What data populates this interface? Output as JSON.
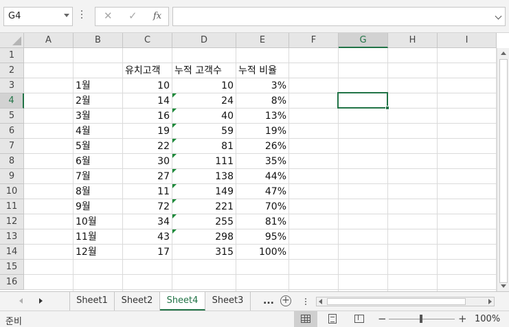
{
  "formula_bar": {
    "name_box": "G4",
    "cancel_icon": "✕",
    "enter_icon": "✓",
    "fx_icon": "fx",
    "formula": ""
  },
  "columns": [
    "A",
    "B",
    "C",
    "D",
    "E",
    "F",
    "G",
    "H",
    "I"
  ],
  "rows": [
    "1",
    "2",
    "3",
    "4",
    "5",
    "6",
    "7",
    "8",
    "9",
    "10",
    "11",
    "12",
    "13",
    "14",
    "15",
    "16"
  ],
  "selected_cell": "G4",
  "headers": {
    "c": "유치고객",
    "d": "누적 고객수",
    "e": "누적 비율"
  },
  "table": [
    {
      "month": "1월",
      "customers": "10",
      "cumulative": "10",
      "ratio": "3%"
    },
    {
      "month": "2월",
      "customers": "14",
      "cumulative": "24",
      "ratio": "8%"
    },
    {
      "month": "3월",
      "customers": "16",
      "cumulative": "40",
      "ratio": "13%"
    },
    {
      "month": "4월",
      "customers": "19",
      "cumulative": "59",
      "ratio": "19%"
    },
    {
      "month": "5월",
      "customers": "22",
      "cumulative": "81",
      "ratio": "26%"
    },
    {
      "month": "6월",
      "customers": "30",
      "cumulative": "111",
      "ratio": "35%"
    },
    {
      "month": "7월",
      "customers": "27",
      "cumulative": "138",
      "ratio": "44%"
    },
    {
      "month": "8월",
      "customers": "11",
      "cumulative": "149",
      "ratio": "47%"
    },
    {
      "month": "9월",
      "customers": "72",
      "cumulative": "221",
      "ratio": "70%"
    },
    {
      "month": "10월",
      "customers": "34",
      "cumulative": "255",
      "ratio": "81%"
    },
    {
      "month": "11월",
      "customers": "43",
      "cumulative": "298",
      "ratio": "95%"
    },
    {
      "month": "12월",
      "customers": "17",
      "cumulative": "315",
      "ratio": "100%"
    }
  ],
  "sheets": [
    {
      "label": "Sheet1",
      "active": false
    },
    {
      "label": "Sheet2",
      "active": false
    },
    {
      "label": "Sheet4",
      "active": true
    },
    {
      "label": "Sheet3",
      "active": false
    }
  ],
  "tabbar": {
    "more": "...",
    "add": "+"
  },
  "status": {
    "ready": "준비",
    "zoom_minus": "−",
    "zoom_plus": "+",
    "zoom": "100%",
    "zoom_level_fraction": 0.5
  },
  "colors": {
    "accent": "#217346",
    "error_flag": "#1e8a3a",
    "header_bg": "#e6e6e6",
    "gridline": "#dadada"
  }
}
